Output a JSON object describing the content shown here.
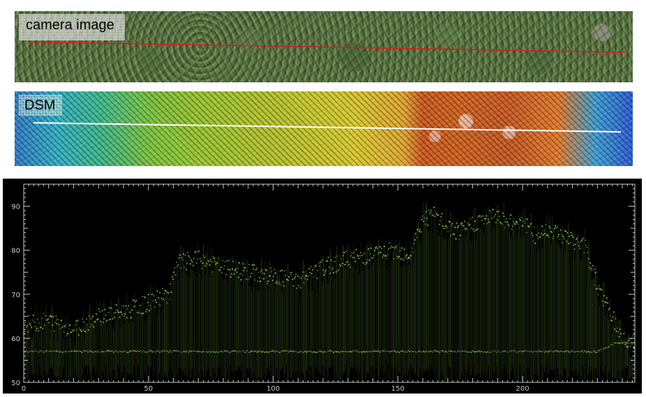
{
  "panels": {
    "camera_image_label": "camera image",
    "dsm_label": "DSM"
  },
  "colors": {
    "camera_transect_line": "#d21e1e",
    "dsm_transect_line": "#ffffff",
    "profile_points": "#8fd14f",
    "plot_background": "#000000",
    "axis_color": "#c8c8c8"
  },
  "chart_data": {
    "type": "scatter",
    "title": "",
    "xlabel": "",
    "ylabel": "",
    "xlim": [
      0,
      245
    ],
    "ylim": [
      50,
      95
    ],
    "x_ticks": [
      0,
      50,
      100,
      150,
      200
    ],
    "y_ticks": [
      50,
      60,
      70,
      80,
      90
    ],
    "grid": false,
    "series": [
      {
        "x": [
          0,
          10,
          20,
          30,
          40,
          50,
          58,
          62,
          70,
          80,
          90,
          100,
          110,
          120,
          130,
          140,
          150,
          155,
          160,
          165,
          170,
          175,
          180,
          185,
          190,
          195,
          200,
          205,
          210,
          215,
          220,
          225,
          230,
          235,
          240,
          245
        ],
        "y": [
          63,
          64,
          62,
          65,
          66,
          68,
          70,
          77,
          78,
          76,
          75,
          74,
          73,
          76,
          78,
          79,
          80,
          79,
          87,
          88,
          85,
          84,
          86,
          87,
          88,
          86,
          87,
          83,
          85,
          84,
          82,
          81,
          72,
          66,
          60,
          59
        ]
      },
      {
        "x": [
          0,
          20,
          40,
          57,
          65,
          100,
          150,
          200,
          230,
          238,
          245
        ],
        "y": [
          57,
          57,
          57,
          57,
          57,
          57,
          57,
          57,
          57,
          59,
          59
        ]
      }
    ]
  }
}
